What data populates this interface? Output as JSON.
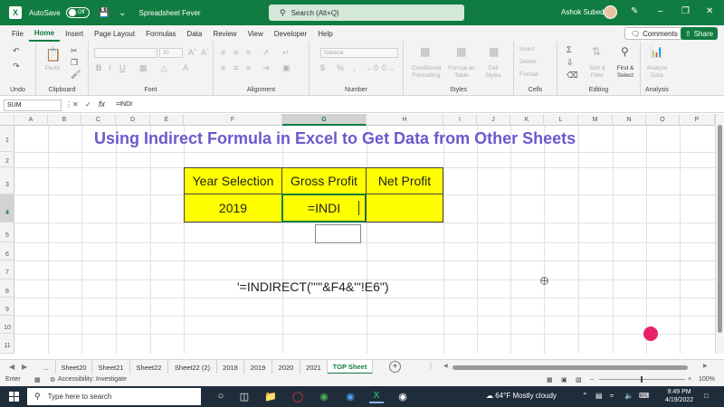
{
  "titlebar": {
    "logo": "X",
    "autosave_label": "AutoSave",
    "autosave_state": "Off",
    "filename": "Spreadsheet Fever",
    "search_placeholder": "Search (Alt+Q)",
    "user": "Ashok Subedi"
  },
  "menu": {
    "items": [
      "File",
      "Home",
      "Insert",
      "Page Layout",
      "Formulas",
      "Data",
      "Review",
      "View",
      "Developer",
      "Help"
    ],
    "active": "Home",
    "comments_label": "Comments",
    "share_label": "Share"
  },
  "ribbon": {
    "groups": [
      "Undo",
      "Clipboard",
      "Font",
      "Alignment",
      "Number",
      "Styles",
      "Cells",
      "Editing",
      "Analysis"
    ],
    "number_format": "General",
    "font_size": "20",
    "paste_label": "Paste",
    "styles": [
      "Conditional Formatting",
      "Format as Table",
      "Cell Styles"
    ],
    "cells": [
      "Insert",
      "Delete",
      "Format"
    ],
    "editing": [
      "Sort & Filter",
      "Find & Select"
    ],
    "analysis": "Analyze Data"
  },
  "formula_bar": {
    "name_box": "SUM",
    "fx": "fx",
    "content": "=INDI"
  },
  "columns": [
    "A",
    "B",
    "C",
    "D",
    "E",
    "F",
    "G",
    "H",
    "I",
    "J",
    "K",
    "L",
    "M",
    "N",
    "O",
    "P"
  ],
  "selected_column": "G",
  "rows": [
    "1",
    "2",
    "3",
    "4",
    "5",
    "6",
    "7",
    "8",
    "9",
    "10",
    "11"
  ],
  "selected_row": "4",
  "sheet": {
    "title": "Using Indirect Formula in Excel to Get Data from Other Sheets",
    "headers": [
      "Year Selection",
      "Gross Profit",
      "Net Profit"
    ],
    "row_values": [
      "2019",
      "=INDI",
      ""
    ],
    "note_formula": "'=INDIRECT(\"'\"&F4&\"'!E6\")"
  },
  "sheet_tabs": {
    "more": "...",
    "tabs": [
      "Sheet20",
      "Sheet21",
      "Sheet22",
      "Sheet22 (2)",
      "2018",
      "2019",
      "2020",
      "2021",
      "TOP Sheet"
    ],
    "active": "TOP Sheet"
  },
  "statusbar": {
    "mode": "Enter",
    "accessibility": "Accessibility: Investigate",
    "zoom": "100%"
  },
  "taskbar": {
    "search_placeholder": "Type here to search",
    "weather_temp": "64°F",
    "weather_desc": "Mostly cloudy",
    "time": "9:49 PM",
    "date": "4/19/2022"
  }
}
